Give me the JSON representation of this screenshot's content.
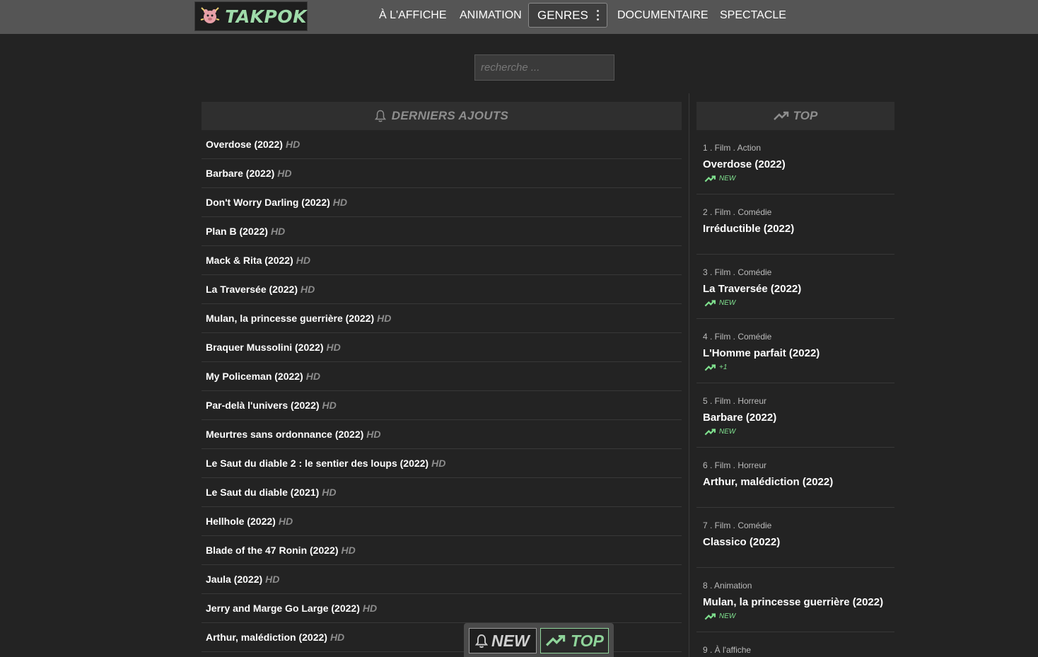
{
  "header": {
    "logo_text": "TAKPOK",
    "nav": [
      {
        "label": "À L'AFFICHE"
      },
      {
        "label": "ANIMATION"
      },
      {
        "label": "GENRES"
      },
      {
        "label": "DOCUMENTAIRE"
      },
      {
        "label": "SPECTACLE"
      }
    ]
  },
  "search": {
    "placeholder": "recherche ..."
  },
  "latest": {
    "title": "DERNIERS AJOUTS",
    "items": [
      {
        "title": "Overdose (2022)",
        "quality": "HD"
      },
      {
        "title": "Barbare (2022)",
        "quality": "HD"
      },
      {
        "title": "Don't Worry Darling (2022)",
        "quality": "HD"
      },
      {
        "title": "Plan B (2022)",
        "quality": "HD"
      },
      {
        "title": "Mack & Rita (2022)",
        "quality": "HD"
      },
      {
        "title": "La Traversée (2022)",
        "quality": "HD"
      },
      {
        "title": "Mulan, la princesse guerrière (2022)",
        "quality": "HD"
      },
      {
        "title": "Braquer Mussolini (2022)",
        "quality": "HD"
      },
      {
        "title": "My Policeman (2022)",
        "quality": "HD"
      },
      {
        "title": "Par-delà l'univers (2022)",
        "quality": "HD"
      },
      {
        "title": "Meurtres sans ordonnance (2022)",
        "quality": "HD"
      },
      {
        "title": "Le Saut du diable 2 : le sentier des loups (2022)",
        "quality": "HD"
      },
      {
        "title": "Le Saut du diable (2021)",
        "quality": "HD"
      },
      {
        "title": "Hellhole (2022)",
        "quality": "HD"
      },
      {
        "title": "Blade of the 47 Ronin (2022)",
        "quality": "HD"
      },
      {
        "title": "Jaula (2022)",
        "quality": "HD"
      },
      {
        "title": "Jerry and Marge Go Large (2022)",
        "quality": "HD"
      },
      {
        "title": "Arthur, malédiction (2022)",
        "quality": "HD"
      }
    ]
  },
  "top": {
    "title": "TOP",
    "items": [
      {
        "category": "1 . Film . Action",
        "title": "Overdose (2022)",
        "trend": "NEW"
      },
      {
        "category": "2 . Film . Comédie",
        "title": "Irréductible (2022)",
        "trend": ""
      },
      {
        "category": "3 . Film . Comédie",
        "title": "La Traversée (2022)",
        "trend": "NEW"
      },
      {
        "category": "4 . Film . Comédie",
        "title": "L'Homme parfait (2022)",
        "trend": "+1"
      },
      {
        "category": "5 . Film . Horreur",
        "title": "Barbare (2022)",
        "trend": "NEW"
      },
      {
        "category": "6 . Film . Horreur",
        "title": "Arthur, malédiction (2022)",
        "trend": ""
      },
      {
        "category": "7 . Film . Comédie",
        "title": "Classico (2022)",
        "trend": ""
      },
      {
        "category": "8 . Animation",
        "title": "Mulan, la princesse guerrière (2022)",
        "trend": "NEW"
      },
      {
        "category": "9 . À l'affiche",
        "title": "",
        "trend": ""
      }
    ]
  },
  "floatbar": {
    "new_label": "NEW",
    "top_label": "TOP"
  },
  "colors": {
    "accent_green": "#7fe08e",
    "topbar_bg": "#555555",
    "page_bg": "#232323"
  }
}
